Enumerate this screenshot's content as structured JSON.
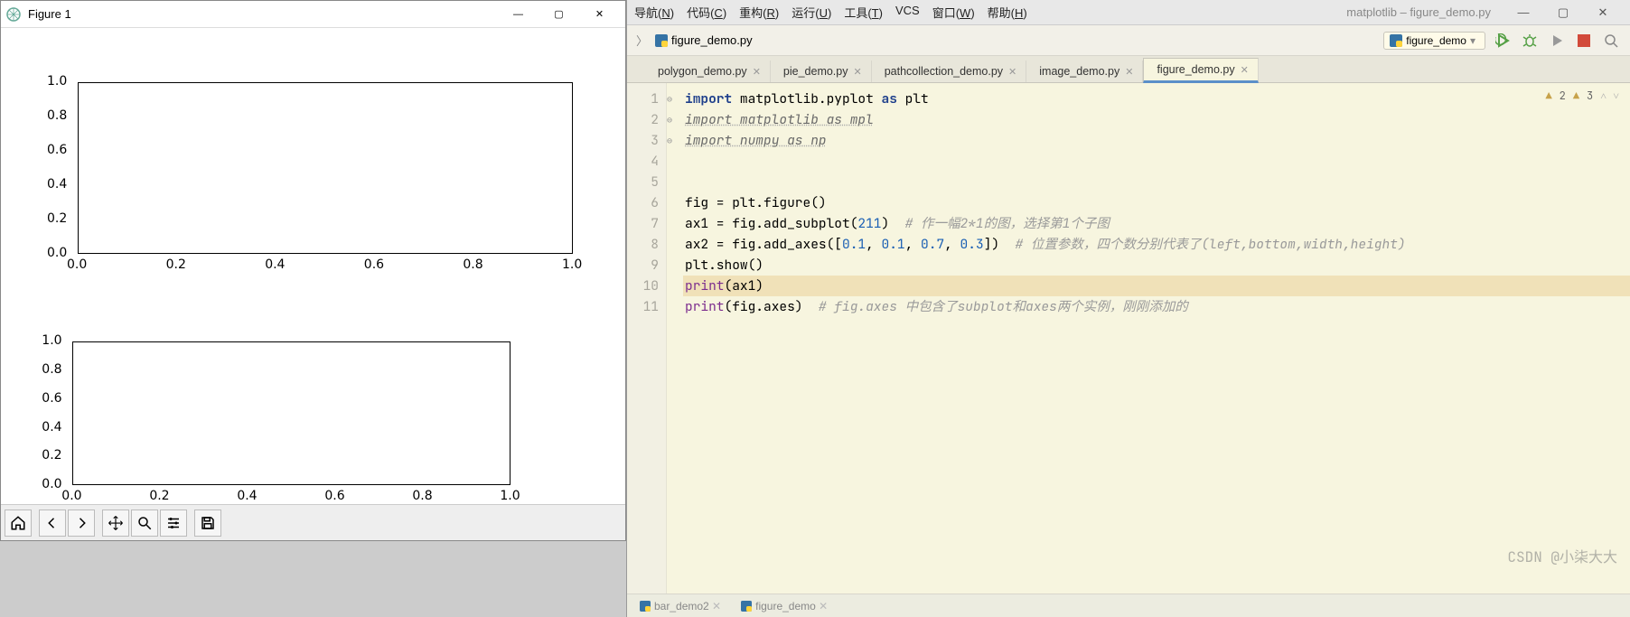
{
  "mpl": {
    "title": "Figure 1",
    "toolbar": [
      "home",
      "back",
      "forward",
      "pan",
      "zoom",
      "configure",
      "save"
    ]
  },
  "chart_data": [
    {
      "type": "line",
      "title": "",
      "xlabel": "",
      "ylabel": "",
      "xlim": [
        0.0,
        1.0
      ],
      "ylim": [
        0.0,
        1.0
      ],
      "xticks": [
        0.0,
        0.2,
        0.4,
        0.6,
        0.8,
        1.0
      ],
      "yticks": [
        0.0,
        0.2,
        0.4,
        0.6,
        0.8,
        1.0
      ],
      "series": [],
      "note": "subplot(211) – upper axes, empty"
    },
    {
      "type": "line",
      "title": "",
      "xlabel": "",
      "ylabel": "",
      "xlim": [
        0.0,
        1.0
      ],
      "ylim": [
        0.0,
        1.0
      ],
      "xticks": [
        0.0,
        0.2,
        0.4,
        0.6,
        0.8,
        1.0
      ],
      "yticks": [
        0.0,
        0.2,
        0.4,
        0.6,
        0.8,
        1.0
      ],
      "series": [],
      "note": "add_axes([0.1,0.1,0.7,0.3]) – lower axes, empty"
    }
  ],
  "ide": {
    "title_suffix": "matplotlib – figure_demo.py",
    "menus": [
      "导航(N)",
      "代码(C)",
      "重构(R)",
      "运行(U)",
      "工具(T)",
      "VCS",
      "窗口(W)",
      "帮助(H)"
    ],
    "breadcrumb": {
      "chev": "〉",
      "file": "figure_demo.py"
    },
    "run_config": "figure_demo",
    "tabs": [
      {
        "label": "polygon_demo.py",
        "active": false
      },
      {
        "label": "pie_demo.py",
        "active": false
      },
      {
        "label": "pathcollection_demo.py",
        "active": false
      },
      {
        "label": "image_demo.py",
        "active": false
      },
      {
        "label": "figure_demo.py",
        "active": true
      }
    ],
    "inspection": {
      "weak": 2,
      "warn": 3
    },
    "code_lines": [
      {
        "n": 1,
        "html": "<span class='kw'>import</span> matplotlib.pyplot <span class='kw'>as</span> plt"
      },
      {
        "n": 2,
        "html": "<span class='imp'>import matplotlib as mpl</span>"
      },
      {
        "n": 3,
        "html": "<span class='imp'>import numpy as np</span>"
      },
      {
        "n": 4,
        "html": ""
      },
      {
        "n": 5,
        "html": ""
      },
      {
        "n": 6,
        "html": "fig = plt.figure()"
      },
      {
        "n": 7,
        "html": "ax1 = fig.add_subplot(<span class='num'>211</span>)  <span class='cmt'># 作一幅2*1的图，选择第1个子图</span>"
      },
      {
        "n": 8,
        "html": "ax2 = fig.add_axes([<span class='num'>0.1</span>, <span class='num'>0.1</span>, <span class='num'>0.7</span>, <span class='num'>0.3</span>])  <span class='cmt'># 位置参数，四个数分别代表了(left,bottom,width,height)</span>"
      },
      {
        "n": 9,
        "html": "plt.show()"
      },
      {
        "n": 10,
        "html": "<span class='builtin'>print</span>(ax1)",
        "hl": true
      },
      {
        "n": 11,
        "html": "<span class='builtin'>print</span>(fig.axes)  <span class='cmt'># fig.axes 中包含了subplot和axes两个实例，刚刚添加的</span>"
      }
    ],
    "footer_tabs": [
      "bar_demo2",
      "figure_demo"
    ],
    "watermark": "CSDN @小柒大大"
  }
}
